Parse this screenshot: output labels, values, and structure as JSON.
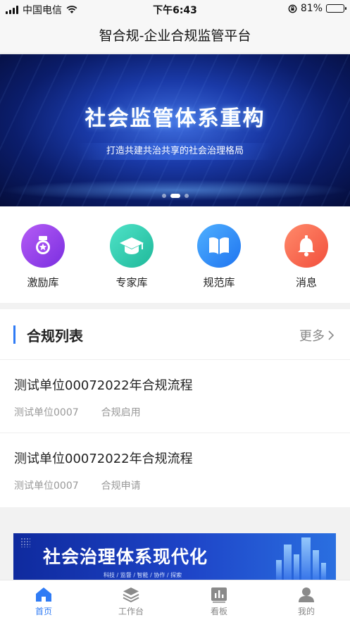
{
  "status_bar": {
    "carrier": "中国电信",
    "time": "下午6:43",
    "battery_text": "81%",
    "battery_level": 0.81
  },
  "nav": {
    "title": "智合规-企业合规监管平台"
  },
  "banner": {
    "title": "社会监管体系重构",
    "subtitle": "打造共建共治共享的社会治理格局",
    "slide_count": 3,
    "active_slide": 2
  },
  "quick_menu": [
    {
      "label": "激励库",
      "icon": "medal-icon",
      "color_from": "#b55cf5",
      "color_to": "#7a2ee0"
    },
    {
      "label": "专家库",
      "icon": "graduation-cap-icon",
      "color_from": "#4fe3c8",
      "color_to": "#1fb89a"
    },
    {
      "label": "规范库",
      "icon": "book-icon",
      "color_from": "#4fb0ff",
      "color_to": "#1f74f0"
    },
    {
      "label": "消息",
      "icon": "bell-icon",
      "color_from": "#ff8a6b",
      "color_to": "#f24f3c"
    }
  ],
  "compliance_list": {
    "title": "合规列表",
    "more_label": "更多",
    "accent": "#2f7bf5",
    "items": [
      {
        "title": "测试单位00072022年合规流程",
        "unit": "测试单位0007",
        "status": "合规启用"
      },
      {
        "title": "测试单位00072022年合规流程",
        "unit": "测试单位0007",
        "status": "合规申请"
      }
    ]
  },
  "banner2": {
    "title": "社会治理体系现代化",
    "subtitle": "科技 / 监督 / 智能 / 协作 / 探索"
  },
  "tab_bar": [
    {
      "label": "首页",
      "icon": "home-icon",
      "active": true
    },
    {
      "label": "工作台",
      "icon": "layers-icon",
      "active": false
    },
    {
      "label": "看板",
      "icon": "dashboard-icon",
      "active": false
    },
    {
      "label": "我的",
      "icon": "user-icon",
      "active": false
    }
  ]
}
